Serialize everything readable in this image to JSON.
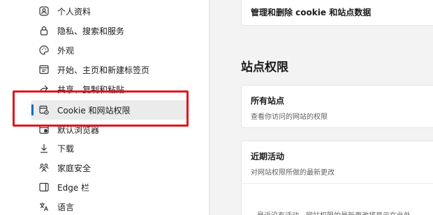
{
  "sidebar": {
    "items": [
      {
        "label": "个人资料",
        "icon": "profile-icon"
      },
      {
        "label": "隐私、搜索和服务",
        "icon": "lock-icon"
      },
      {
        "label": "外观",
        "icon": "palette-icon"
      },
      {
        "label": "开始、主页和新建标签页",
        "icon": "window-icon"
      },
      {
        "label": "共享、复制和粘贴",
        "icon": "share-icon"
      },
      {
        "label": "Cookie 和网站权限",
        "icon": "cookie-settings-icon"
      },
      {
        "label": "默认浏览器",
        "icon": "browser-icon"
      },
      {
        "label": "下载",
        "icon": "download-icon"
      },
      {
        "label": "家庭安全",
        "icon": "family-icon"
      },
      {
        "label": "Edge 栏",
        "icon": "edge-bar-icon"
      },
      {
        "label": "语言",
        "icon": "language-icon"
      }
    ]
  },
  "main": {
    "top_card_title": "管理和删除 cookie 和站点数据",
    "section_heading": "站点权限",
    "all_sites": {
      "title": "所有站点",
      "desc": "查看你访问的网站的权限"
    },
    "recent": {
      "title": "近期活动",
      "desc": "对网站权限所做的最新更改",
      "empty_text": "最近没有活动。网站权限的最新更改将显示在此处"
    }
  },
  "colors": {
    "accent": "#0f6cbd",
    "highlight": "#e0131b"
  }
}
